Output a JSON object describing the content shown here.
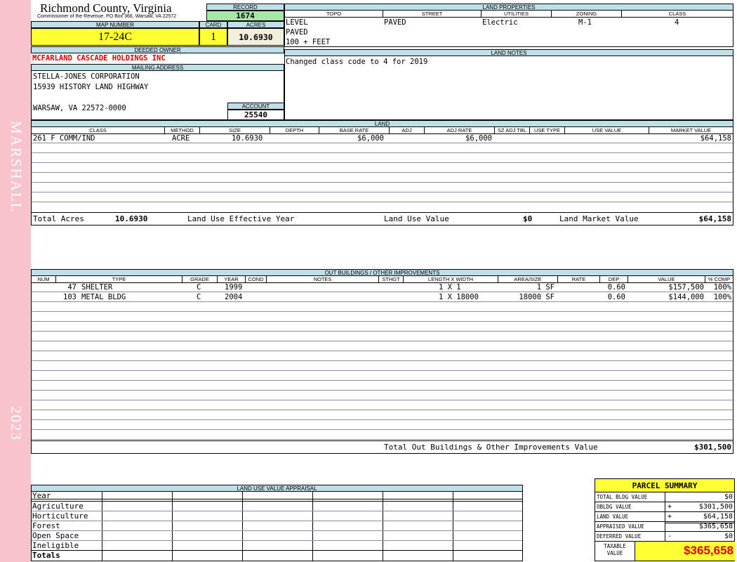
{
  "sidebar": {
    "district": "MARSHALL",
    "year": "2023"
  },
  "county": {
    "name": "Richmond County, Virginia",
    "subtitle": "Commissioner of the Revenue, PO Box 366, Warsaw, VA 22572"
  },
  "record": {
    "label": "RECORD",
    "value": "1674"
  },
  "map_number": {
    "label": "MAP NUMBER",
    "value": "17-24C"
  },
  "card": {
    "label": "CARD",
    "value": "1"
  },
  "acres": {
    "label": "ACRES",
    "value": "10.6930"
  },
  "deeded_owner": {
    "label": "DEEDED OWNER",
    "value": "MCFARLAND CASCADE HOLDINGS INC"
  },
  "mailing_address": {
    "label": "MAILING ADDRESS",
    "line1": "STELLA-JONES CORPORATION",
    "line2": "15939 HISTORY LAND HIGHWAY",
    "line3": "WARSAW, VA 22572-0000"
  },
  "account": {
    "label": "ACCOUNT",
    "value": "25540"
  },
  "land_properties": {
    "label": "LAND PROPERTIES",
    "headers": {
      "topo": "TOPO",
      "street": "STREET",
      "utilities": "UTILITIES",
      "zoning": "ZONING",
      "class": "CLASS"
    },
    "topo": [
      "LEVEL",
      "PAVED",
      "100 + FEET"
    ],
    "street": "PAVED",
    "utilities": "Electric",
    "zoning": "M-1",
    "class": "4"
  },
  "land_notes": {
    "label": "LAND NOTES",
    "text": "Changed class code to 4 for 2019"
  },
  "land": {
    "label": "LAND",
    "headers": {
      "class": "CLASS",
      "method": "METHOD",
      "size": "SIZE",
      "depth": "DEPTH",
      "base_rate": "BASE RATE",
      "adj": "ADJ",
      "adj_rate": "ADJ RATE",
      "sz_adj_tbl": "SZ ADJ TBL",
      "use_type": "USE TYPE",
      "use_value": "USE VALUE",
      "market_value": "MARKET VALUE"
    },
    "rows": [
      {
        "class": "261 F COMM/IND",
        "method": "ACRE",
        "size": "10.6930",
        "depth": "",
        "base_rate": "$6,000",
        "adj": "",
        "adj_rate": "$6,000",
        "sz_adj_tbl": "",
        "use_type": "",
        "use_value": "",
        "market_value": "$64,158"
      }
    ],
    "totals": {
      "total_acres_label": "Total Acres",
      "total_acres": "10.6930",
      "effective_year_label": "Land Use Effective Year",
      "use_value_label": "Land Use Value",
      "use_value": "$0",
      "market_value_label": "Land Market Value",
      "market_value": "$64,158"
    }
  },
  "outbuildings": {
    "label": "OUT BUILDINGS / OTHER IMPROVEMENTS",
    "headers": {
      "num": "NUM",
      "type": "TYPE",
      "grade": "GRADE",
      "year": "YEAR",
      "cond": "COND",
      "notes": "NOTES",
      "sthgt": "STHGT",
      "length_width": "LENGTH X WIDTH",
      "area_size": "AREA/SIZE",
      "rate": "RATE",
      "dep": "DEP",
      "value": "VALUE",
      "pct_comp": "% COMP"
    },
    "rows": [
      {
        "num": "47",
        "type": "SHELTER",
        "grade": "C",
        "year": "1999",
        "cond": "",
        "notes": "",
        "sthgt": "",
        "length_width": "1 X 1",
        "area_size": "1 SF",
        "rate": "",
        "dep": "0.60",
        "value": "$157,500",
        "pct_comp": "100%"
      },
      {
        "num": "103",
        "type": "METAL BLDG",
        "grade": "C",
        "year": "2004",
        "cond": "",
        "notes": "",
        "sthgt": "",
        "length_width": "1 X 18000",
        "area_size": "18000 SF",
        "rate": "",
        "dep": "0.60",
        "value": "$144,000",
        "pct_comp": "100%"
      }
    ],
    "total_label": "Total Out Buildings & Other Improvements Value",
    "total_value": "$301,500"
  },
  "land_use_appraisal": {
    "label": "LAND USE VALUE APPRAISAL",
    "rows": [
      "Year",
      "Agriculture",
      "Horticulture",
      "Forest",
      "Open Space",
      "Ineligible",
      "Totals"
    ]
  },
  "parcel_summary": {
    "title": "PARCEL SUMMARY",
    "rows": [
      {
        "label": "TOTAL BLDG VALUE",
        "sign": "",
        "value": "$0"
      },
      {
        "label": "OBLDG VALUE",
        "sign": "+",
        "value": "$301,500"
      },
      {
        "label": "LAND VALUE",
        "sign": "+",
        "value": "$64,158"
      },
      {
        "label": "APPRAISED VALUE",
        "sign": "",
        "value": "$365,658"
      },
      {
        "label": "DEFERRED VALUE",
        "sign": "-",
        "value": "$0"
      }
    ],
    "taxable_label_1": "TAXABLE",
    "taxable_label_2": "VALUE",
    "taxable_value": "$365,658"
  },
  "colors": {
    "sidebar": "#f7c3cd",
    "header_bar": "#bfe0e8",
    "highlight_yellow": "#ffff33",
    "record_green": "#a6e6a6",
    "owner_red": "#dd0000"
  }
}
